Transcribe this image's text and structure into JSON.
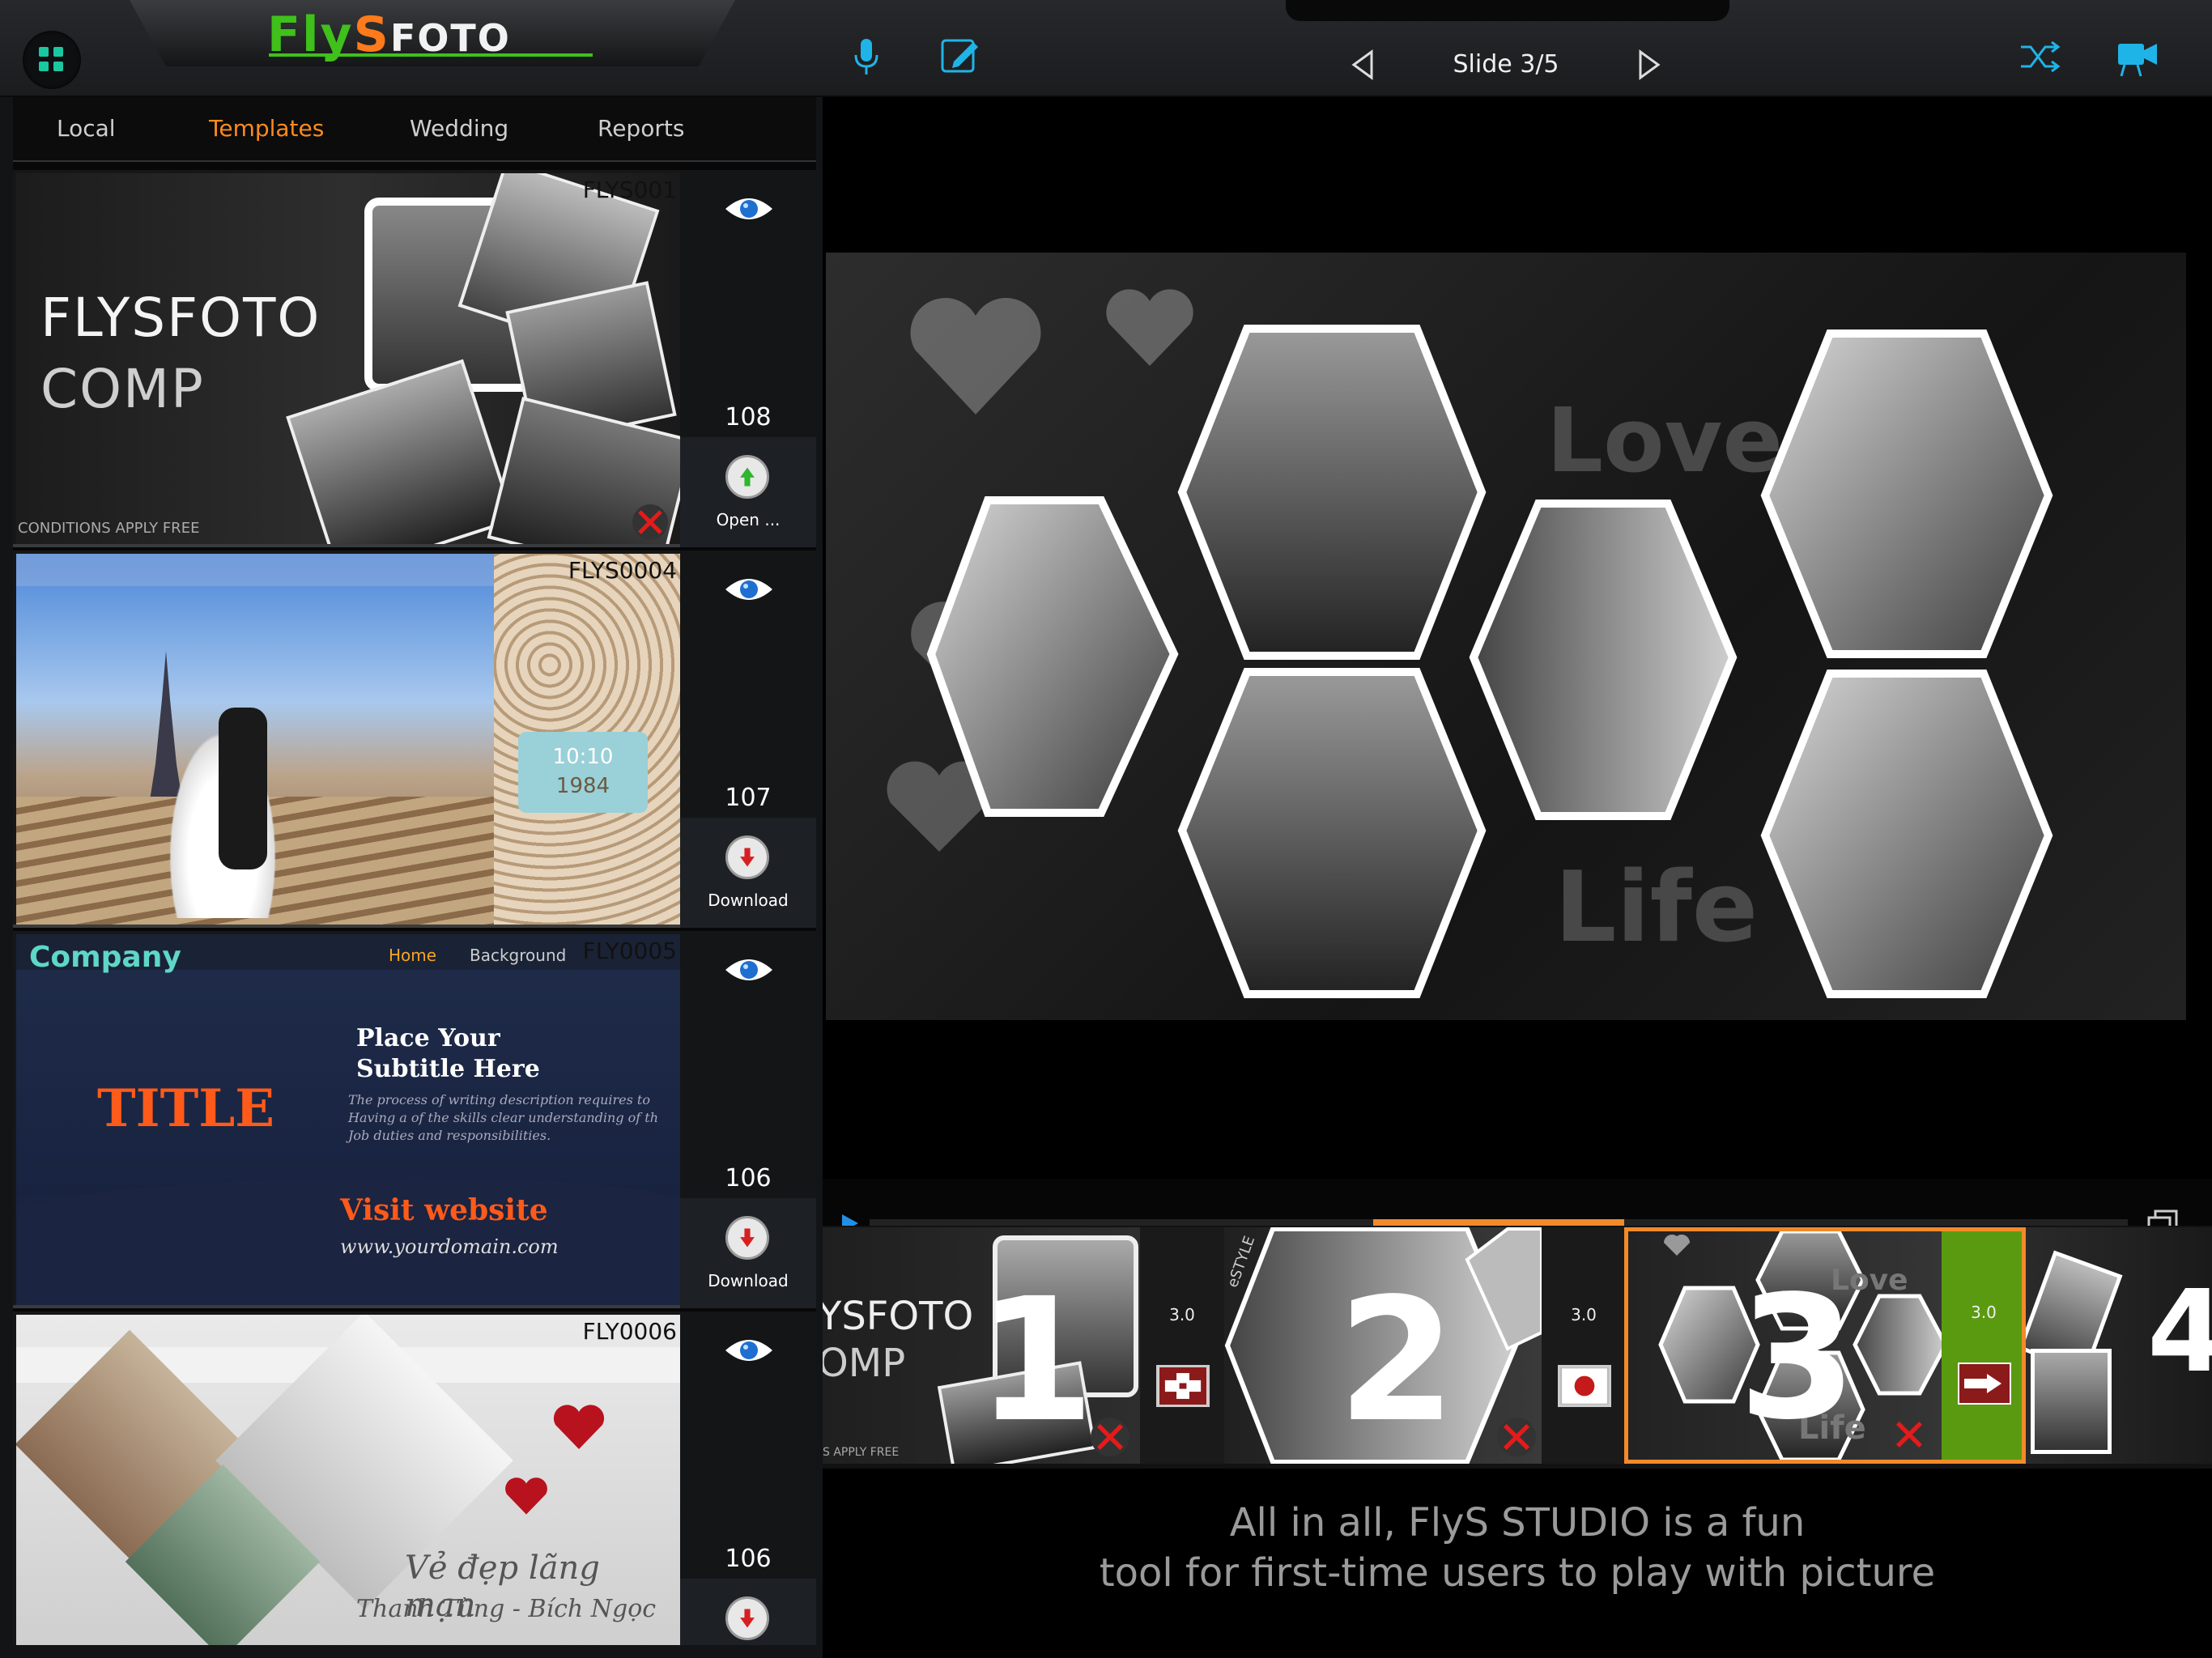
{
  "app": {
    "logo_fly": "Fly",
    "logo_s": "S",
    "logo_foto": "FOTO"
  },
  "toolbar": {
    "slide_label": "Slide 3/5",
    "icons": [
      "grid-icon",
      "microphone-icon",
      "edit-icon",
      "previous-icon",
      "next-icon",
      "shuffle-icon",
      "video-camera-icon"
    ]
  },
  "tabs": [
    {
      "label": "Local"
    },
    {
      "label": "Templates",
      "active": true
    },
    {
      "label": "Wedding"
    },
    {
      "label": "Reports"
    }
  ],
  "templates": [
    {
      "code": "FLYS001",
      "count": "108",
      "action": "Open ...",
      "title1": "FLYSFOTO",
      "title2": "COMP",
      "footer": "CONDITIONS APPLY FREE"
    },
    {
      "code": "FLYS0004",
      "count": "107",
      "action": "Download",
      "date": "10:10",
      "year": "1984"
    },
    {
      "code": "FLY0005",
      "count": "106",
      "action": "Download",
      "company": "Company",
      "nav_home": "Home",
      "nav_bg": "Background",
      "subtitle": "Place Your Subtitle Here",
      "body": "The process of writing description requires to Having a of the skills clear understanding of th Job duties and responsibilities.",
      "title": "TITLE",
      "visit": "Visit website",
      "domain": "www.yourdomain.com"
    },
    {
      "code": "FLY0006",
      "count": "106",
      "script1": "Vẻ đẹp lãng mạn",
      "script2": "Thanh Tùng - Bích Ngọc"
    }
  ],
  "preview": {
    "word_love": "Love",
    "word_life": "Life"
  },
  "timeline": {
    "progress": 0.375,
    "frames": [
      {
        "number": "1",
        "text1": "YSFOTO",
        "text2": "OMP",
        "footer": "S APPLY FREE"
      },
      {
        "number": "2",
        "side_text": "eSTYLE"
      },
      {
        "number": "3",
        "word_love": "Love",
        "word_life": "Life"
      },
      {
        "number": "4"
      }
    ],
    "durations": [
      "3.0",
      "3.0",
      "3.0"
    ]
  },
  "caption": {
    "line1": "All in all, FlyS STUDIO is a fun",
    "line2": "tool for first-time users to play with picture"
  }
}
